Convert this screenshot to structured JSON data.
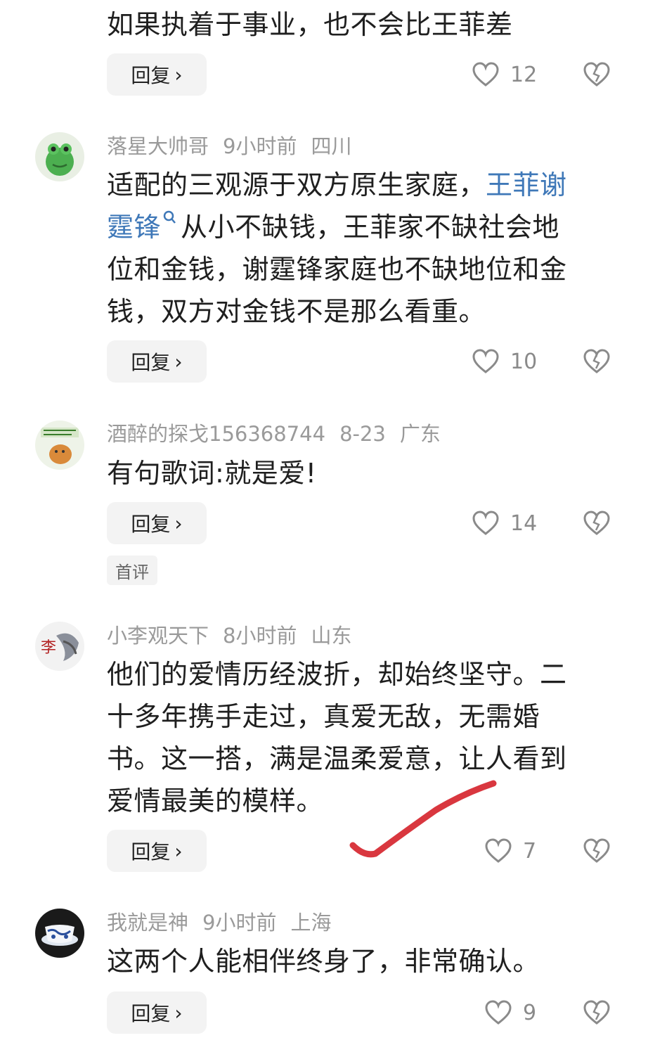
{
  "comments": [
    {
      "lines": [
        "如果执着于事业，也不会比王菲差"
      ],
      "reply_label": "回复",
      "likes": "12"
    },
    {
      "user": "落星大帅哥",
      "time": "9小时前",
      "location": "四川",
      "line1_a": "适配的三观源于双方原生家庭，",
      "line1_link": "王菲谢",
      "line2_link": "霆锋",
      "line2_rest": "从小不缺钱，王菲家不缺社会地",
      "line3": "位和金钱，谢霆锋家庭也不缺地位和金",
      "line4": "钱，双方对金钱不是那么看重。",
      "reply_label": "回复",
      "likes": "10"
    },
    {
      "user": "酒醉的探戈156368744",
      "time": "8-23",
      "location": "广东",
      "lines": [
        "有句歌词:就是爱!"
      ],
      "reply_label": "回复",
      "likes": "14",
      "badge": "首评"
    },
    {
      "user": "小李观天下",
      "time": "8小时前",
      "location": "山东",
      "lines": [
        "他们的爱情历经波折，却始终坚守。二",
        "十多年携手走过，真爱无敌，无需婚",
        "书。这一搭，满是温柔爱意，让人看到",
        "爱情最美的模样。"
      ],
      "avatar_char": "李",
      "reply_label": "回复",
      "likes": "7"
    },
    {
      "user": "我就是神",
      "time": "9小时前",
      "location": "上海",
      "lines": [
        "这两个人能相伴终身了，非常确认。"
      ],
      "reply_label": "回复",
      "likes": "9"
    }
  ],
  "icons": {
    "like": "heart-outline-icon",
    "dislike": "broken-heart-icon",
    "search_hint": "magnifier-icon",
    "annotation": "red-checkmark"
  },
  "colors": {
    "link": "#3f78b8",
    "annotation": "#d9373f"
  }
}
